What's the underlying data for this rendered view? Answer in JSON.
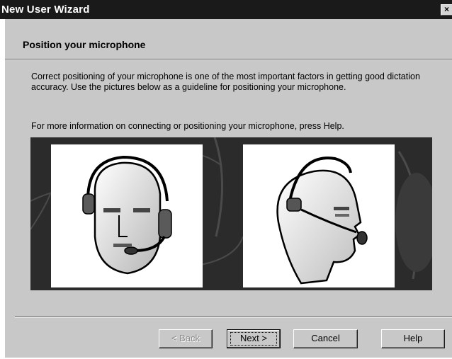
{
  "window": {
    "title": "New User Wizard",
    "close_glyph": "×"
  },
  "page": {
    "heading": "Position your microphone",
    "paragraph1": "Correct positioning of your microphone is one of the most important factors in getting good dictation accuracy.  Use the pictures below as a guideline for positioning your microphone.",
    "paragraph2": "For more information on connecting or positioning your microphone, press Help."
  },
  "illustrations": {
    "front_view": "headset-front-view-illustration",
    "side_view": "headset-side-view-illustration"
  },
  "buttons": {
    "back_label": "< Back",
    "next_label": "Next >",
    "cancel_label": "Cancel",
    "help_label": "Help",
    "back_enabled": false
  },
  "colors": {
    "titlebar": "#1a1a1a",
    "dialog_bg": "#c8c8c8",
    "illustration_panel": "#2b2b2b"
  }
}
